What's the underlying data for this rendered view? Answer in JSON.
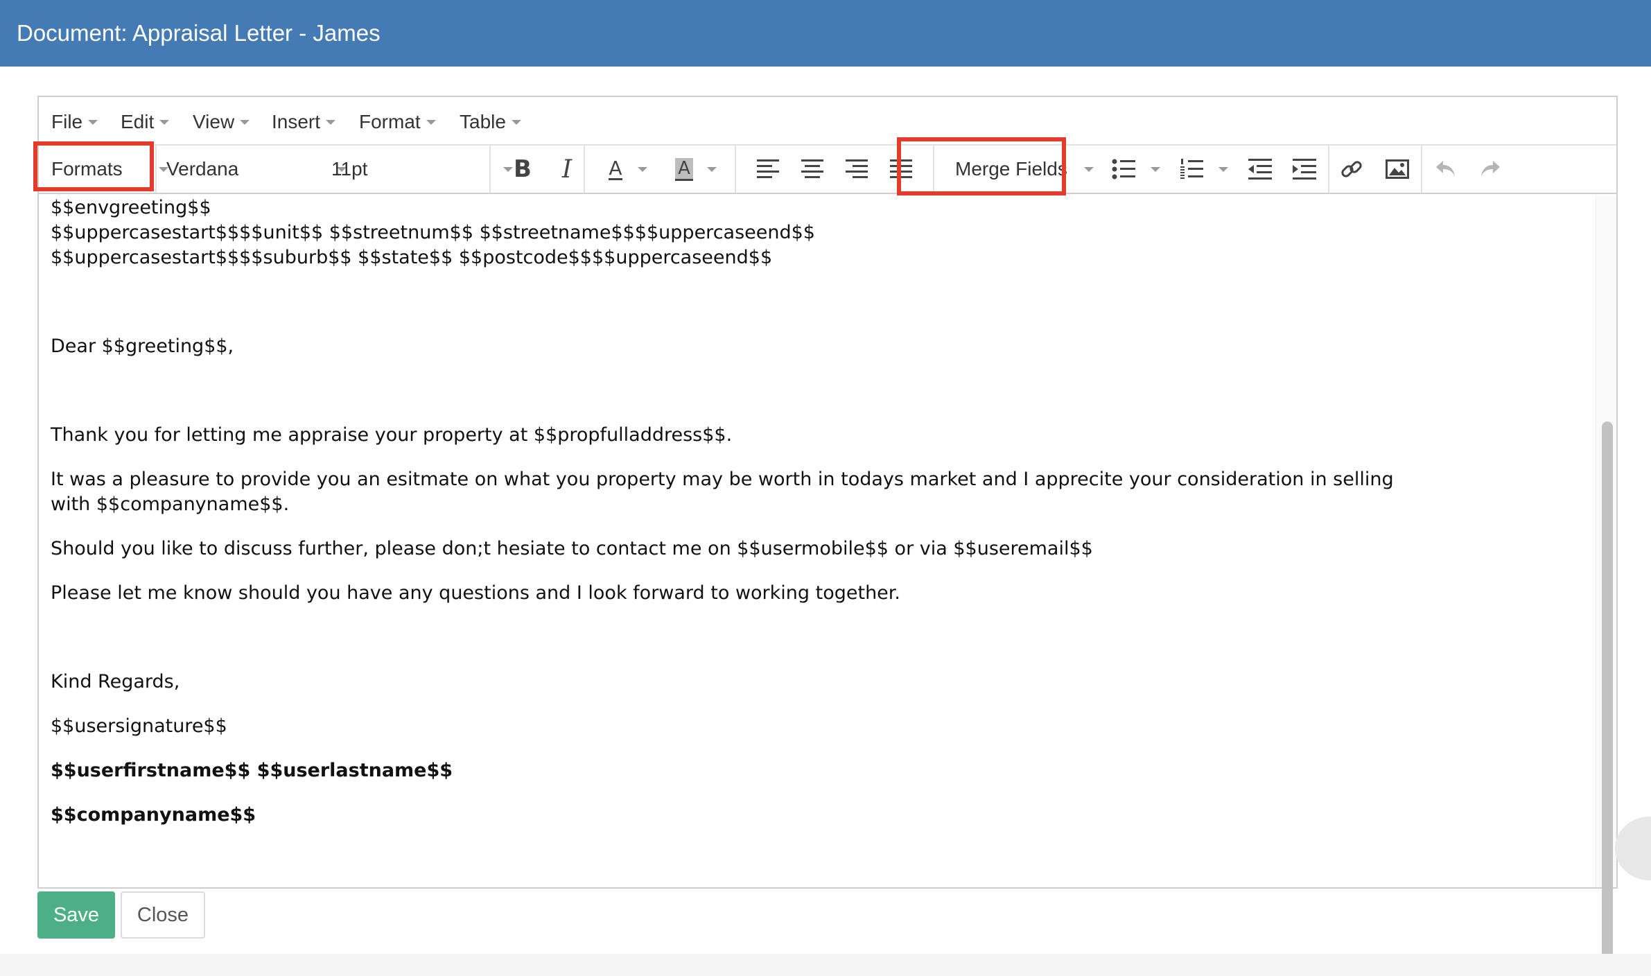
{
  "window": {
    "title": "Document: Appraisal Letter - James"
  },
  "menubar": {
    "items": [
      {
        "label": "File"
      },
      {
        "label": "Edit"
      },
      {
        "label": "View"
      },
      {
        "label": "Insert"
      },
      {
        "label": "Format"
      },
      {
        "label": "Table"
      }
    ]
  },
  "toolbar": {
    "formats_label": "Formats",
    "font_family": "Verdana",
    "font_size": "11pt",
    "merge_fields_label": "Merge Fields",
    "icons": [
      "bold-icon",
      "italic-icon",
      "text-color-icon",
      "background-color-icon",
      "align-left-icon",
      "align-center-icon",
      "align-right-icon",
      "align-justify-icon",
      "bullet-list-icon",
      "numbered-list-icon",
      "outdent-icon",
      "indent-icon",
      "link-icon",
      "image-icon",
      "undo-icon",
      "redo-icon"
    ],
    "highlight_color": "#e33c2c"
  },
  "document": {
    "lines": [
      "$$envgreeting$$",
      "$$uppercasestart$$$$unit$$ $$streetnum$$ $$streetname$$$$uppercaseend$$",
      "$$uppercasestart$$$$suburb$$ $$state$$ $$postcode$$$$uppercaseend$$",
      "Dear $$greeting$$,",
      "Thank you for letting me appraise your property at $$propfulladdress$$.",
      "It was a pleasure to provide you an esitmate on what you property may be worth in todays market and I apprecite your consideration in selling",
      "with $$companyname$$.",
      "Should you like to discuss further, please don;t hesiate to contact me on $$usermobile$$ or via $$useremail$$",
      "Please let me know should you have any questions and I look forward to working together.",
      "Kind Regards,",
      "$$usersignature$$",
      "$$userfirstname$$ $$userlastname$$",
      "$$companyname$$"
    ]
  },
  "actions": {
    "save_label": "Save",
    "close_label": "Close"
  },
  "colors": {
    "title_bar": "#457bb4",
    "save_button": "#4caf86"
  }
}
